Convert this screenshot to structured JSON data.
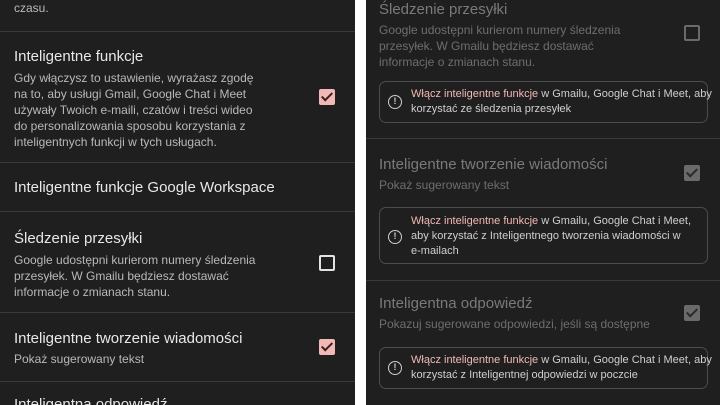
{
  "left": {
    "top_fragment": "czasu.",
    "smart_features": {
      "title": "Inteligentne funkcje",
      "desc_lines": [
        "Gdy włączysz to ustawienie, wyrażasz zgodę",
        "na to, aby usługi Gmail, Google Chat i Meet",
        "używały Twoich e-maili, czatów i treści wideo",
        "do personalizowania sposobu korzystania z",
        "inteligentnych funkcji w tych usługach."
      ],
      "checked": true
    },
    "workspace": {
      "title": "Inteligentne funkcje Google Workspace"
    },
    "tracking": {
      "title": "Śledzenie przesyłki",
      "desc_lines": [
        "Google udostępni kurierom numery śledzenia",
        "przesyłek. W Gmailu będziesz dostawać",
        "informacje o zmianach stanu."
      ],
      "checked": false
    },
    "smart_compose": {
      "title": "Inteligentne tworzenie wiadomości",
      "desc": "Pokaż sugerowany tekst",
      "checked": true
    },
    "bottom_fragment": "Inteligentna odpowiedź"
  },
  "right": {
    "tracking": {
      "title": "Śledzenie przesyłki",
      "desc_lines": [
        "Google udostępni kurierom numery śledzenia",
        "przesyłek. W Gmailu będziesz dostawać",
        "informacje o zmianach stanu."
      ],
      "checked": false,
      "notice": {
        "link": "Włącz inteligentne funkcje",
        "line1_rest": " w Gmailu, Google Chat i Meet, aby",
        "line2": "korzystać ze śledzenia przesyłek"
      }
    },
    "smart_compose": {
      "title": "Inteligentne tworzenie wiadomości",
      "desc": "Pokaż sugerowany tekst",
      "checked": true,
      "notice": {
        "link": "Włącz inteligentne funkcje",
        "line1_rest": " w Gmailu, Google Chat i Meet,",
        "line2": "aby korzystać z Inteligentnego tworzenia wiadomości w",
        "line3": "e-mailach"
      }
    },
    "smart_reply": {
      "title": "Inteligentna odpowiedź",
      "desc": "Pokazuj sugerowane odpowiedzi, jeśli są dostępne",
      "checked": true,
      "notice": {
        "link": "Włącz inteligentne funkcje",
        "line1_rest": " w Gmailu, Google Chat i Meet, aby",
        "line2": "korzystać z Inteligentnej odpowiedzi w poczcie"
      }
    }
  },
  "colors": {
    "background": "#1f1f1f",
    "accent": "#f2b8b5",
    "divider": "#3a3a3a"
  },
  "icons": {
    "info": "info-circle-icon",
    "checkbox_checked": "checkbox-checked-icon",
    "checkbox_unchecked": "checkbox-unchecked-icon"
  }
}
